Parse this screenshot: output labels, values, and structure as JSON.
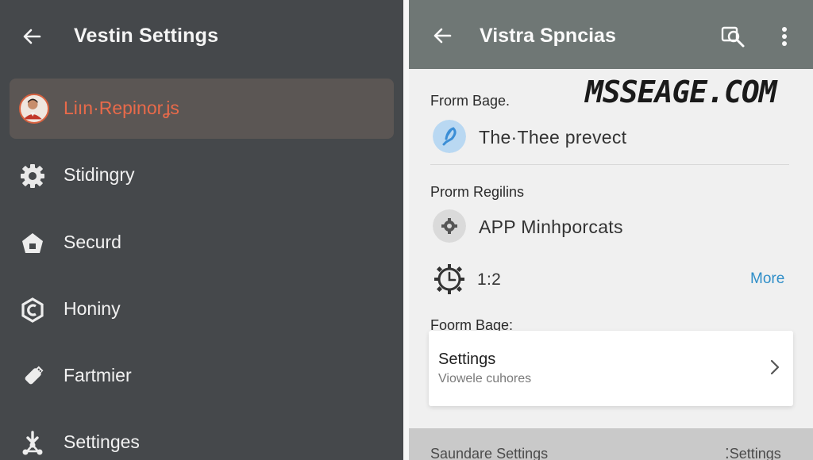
{
  "left_panel": {
    "title": "Vestin Settings",
    "items": [
      {
        "label": "Liın·Repinorʝs",
        "icon": "user-avatar"
      },
      {
        "label": "Stidingry",
        "icon": "gear-icon"
      },
      {
        "label": "Securd",
        "icon": "shield-home-icon"
      },
      {
        "label": "Honiny",
        "icon": "hexagon-c-icon"
      },
      {
        "label": "Fartmier",
        "icon": "usb-stick-icon"
      },
      {
        "label": "Settinges",
        "icon": "download-nodes-icon"
      }
    ],
    "active_index": 0
  },
  "right_panel": {
    "title": "Vistra Spncias",
    "watermark": "MSSEAGE.COM",
    "section1_label": "Frorm Bage.",
    "row1_text": "The·Thee prevect",
    "section2_label": "Prorm Regilins",
    "row2_text": "APP Minhporcats",
    "row3_text": "1:2",
    "more_label": "More",
    "section3_label": "Foorm Bage:",
    "card": {
      "title": "Settings",
      "subtitle": "Viowele cuhores"
    },
    "bottom": {
      "left_label": "Saundare Settings",
      "right_label": "⁚Settings"
    }
  },
  "colors": {
    "left_bg": "#45484b",
    "active_bg": "#5b5654",
    "active_text": "#e96a4a",
    "right_header": "#6f7775",
    "link": "#2f8ec8"
  }
}
